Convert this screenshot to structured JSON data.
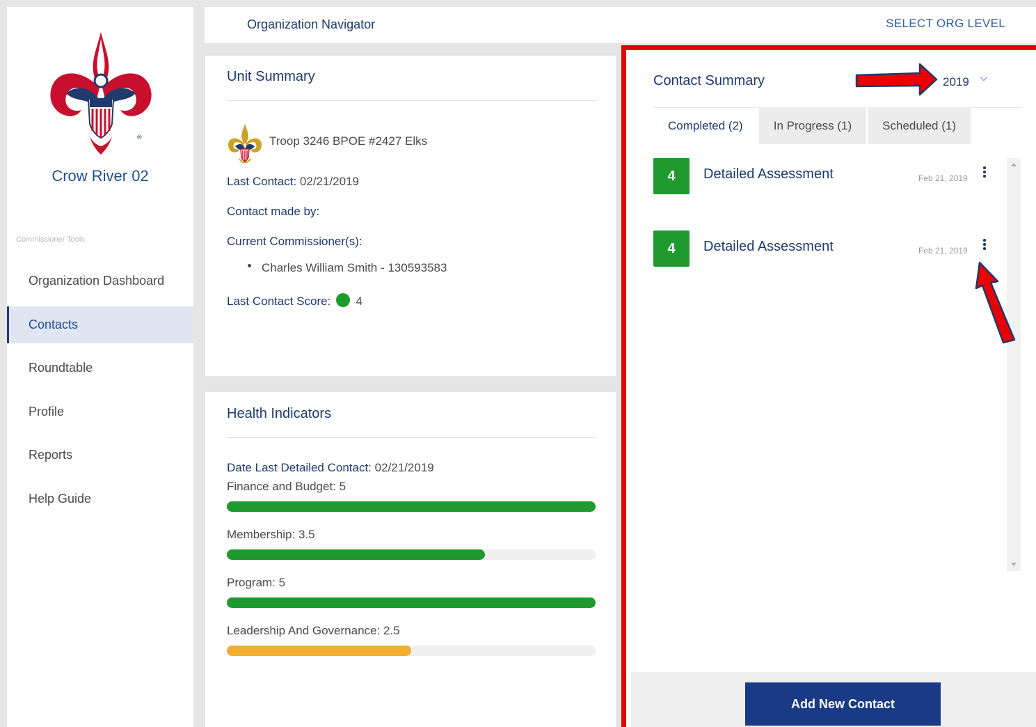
{
  "sidebar": {
    "org_name": "Crow River 02",
    "section_label": "Commissioner Tools",
    "items": [
      {
        "label": "Organization Dashboard"
      },
      {
        "label": "Contacts"
      },
      {
        "label": "Roundtable"
      },
      {
        "label": "Profile"
      },
      {
        "label": "Reports"
      },
      {
        "label": "Help Guide"
      }
    ]
  },
  "topbar": {
    "title": "Organization Navigator",
    "select_org_level": "SELECT ORG LEVEL"
  },
  "unit_summary": {
    "title": "Unit Summary",
    "unit_name": "Troop 3246 BPOE #2427 Elks",
    "last_contact_label": "Last Contact:",
    "last_contact_value": "02/21/2019",
    "contact_made_by_label": "Contact made by:",
    "commissioners_label": "Current Commissioner(s):",
    "commissioners": [
      "Charles William Smith - 130593583"
    ],
    "last_score_label": "Last Contact Score:",
    "last_score_value": "4"
  },
  "health_indicators": {
    "title": "Health Indicators",
    "date_label": "Date Last Detailed Contact:",
    "date_value": "02/21/2019",
    "indicators": [
      {
        "label": "Finance and Budget:",
        "value": "5",
        "fraction": 1.0,
        "color": "#1e9a2e"
      },
      {
        "label": "Membership:",
        "value": "3.5",
        "fraction": 0.7,
        "color": "#1e9a2e"
      },
      {
        "label": "Program:",
        "value": "5",
        "fraction": 1.0,
        "color": "#1e9a2e"
      },
      {
        "label": "Leadership And Governance:",
        "value": "2.5",
        "fraction": 0.5,
        "color": "#f2ae2e"
      }
    ]
  },
  "contact_summary": {
    "title": "Contact Summary",
    "year": "2019",
    "tabs": [
      {
        "label": "Completed (2)"
      },
      {
        "label": "In Progress (1)"
      },
      {
        "label": "Scheduled (1)"
      }
    ],
    "contacts": [
      {
        "score": "4",
        "title": "Detailed Assessment",
        "date": "Feb 21, 2019"
      },
      {
        "score": "4",
        "title": "Detailed Assessment",
        "date": "Feb 21, 2019"
      }
    ],
    "add_button": "Add New Contact"
  },
  "colors": {
    "brand_navy": "#1f3a6b",
    "success_green": "#1e9a2e",
    "warning_amber": "#f2ae2e",
    "highlight_red": "#e80000",
    "button_blue": "#1a3a85"
  }
}
